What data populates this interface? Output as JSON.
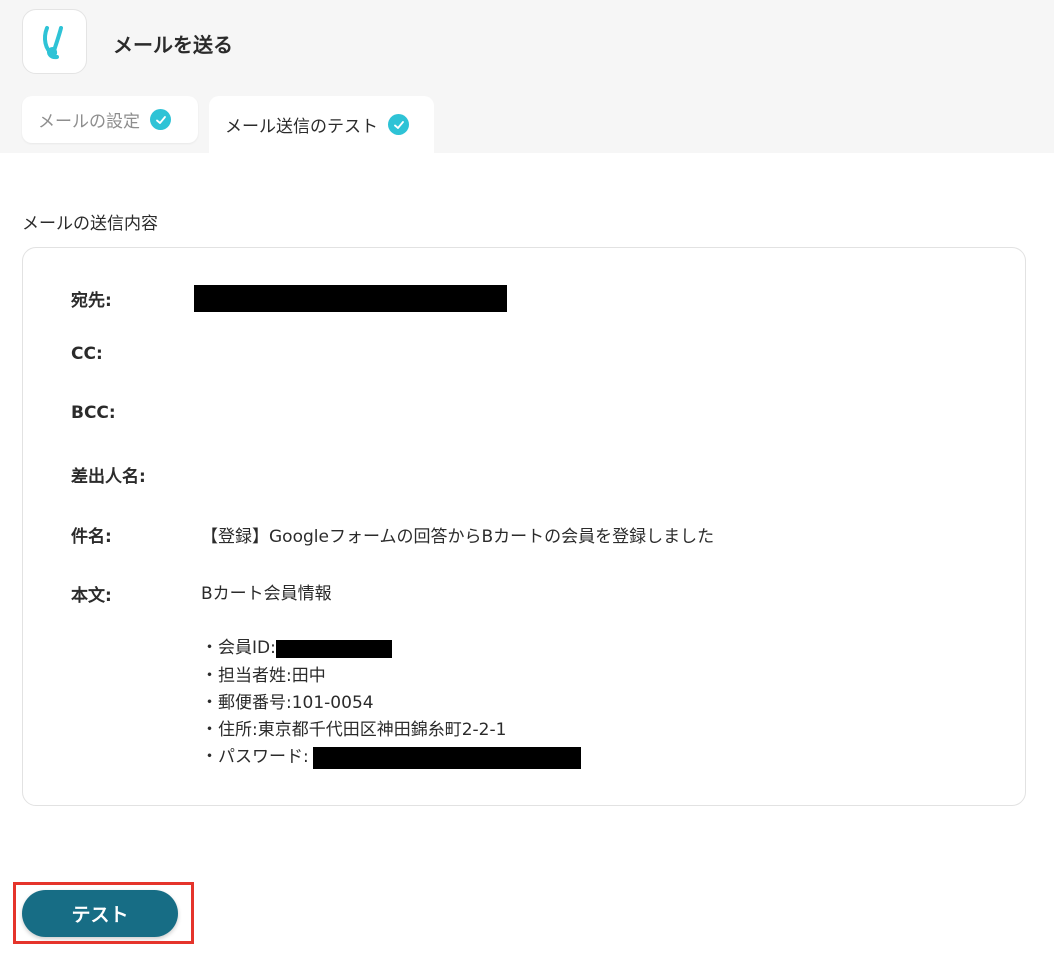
{
  "header": {
    "title": "メールを送る",
    "logo_icon": "yoom-logo-icon",
    "logo_color": "#2ec3d6"
  },
  "tabs": [
    {
      "label": "メールの設定",
      "completed": true
    },
    {
      "label": "メール送信のテスト",
      "completed": true
    }
  ],
  "section": {
    "title": "メールの送信内容"
  },
  "mail": {
    "to_label": "宛先:",
    "cc_label": "CC:",
    "bcc_label": "BCC:",
    "sender_label": "差出人名:",
    "subject_label": "件名:",
    "subject": "【登録】Googleフォームの回答からBカートの会員を登録しました",
    "body_label": "本文:",
    "body": {
      "heading": "Bカート会員情報",
      "member_id_label": "・会員ID:",
      "contact_line": "・担当者姓:田中",
      "postal_line": "・郵便番号:101-0054",
      "address_line": "・住所:東京都千代田区神田錦糸町2-2-1",
      "password_label": "・パスワード:"
    }
  },
  "actions": {
    "test_label": "テスト"
  },
  "colors": {
    "accent": "#2ec3d6",
    "button": "#176d85",
    "highlight": "#e5342b"
  }
}
